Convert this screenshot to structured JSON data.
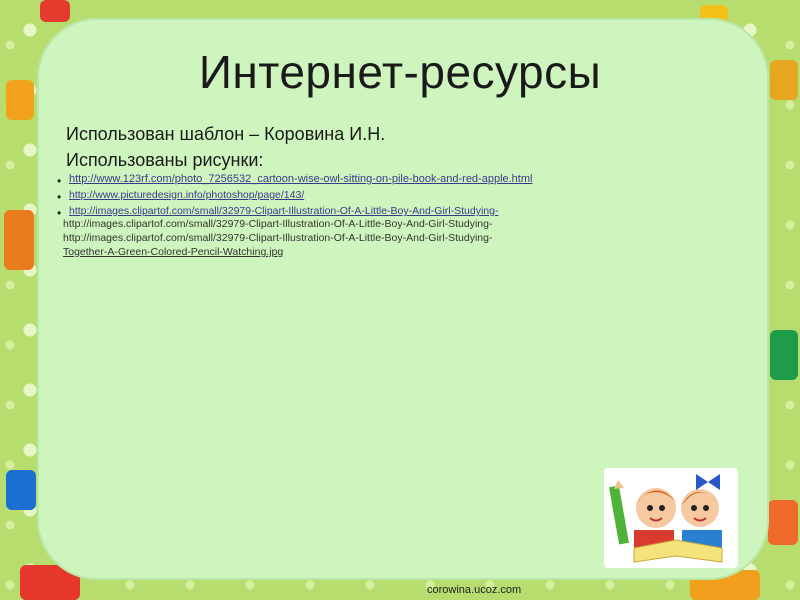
{
  "slide": {
    "title": "Интернет-ресурсы",
    "line1": "Использован шаблон – Коровина И.Н.",
    "line2": "Использованы рисунки:",
    "links": [
      "http://www.123rf.com/photo_7256532_cartoon-wise-owl-sitting-on-pile-book-and-red-apple.html",
      "http://www.picturedesign.info/photoshop/page/143/",
      "http://images.clipartof.com/small/32979-Clipart-Illustration-Of-A-Little-Boy-And-Girl-Studying-"
    ],
    "extra_lines": [
      "http://images.clipartof.com/small/32979-Clipart-Illustration-Of-A-Little-Boy-And-Girl-Studying-",
      "http://images.clipartof.com/small/32979-Clipart-Illustration-Of-A-Little-Boy-And-Girl-Studying-",
      "Together-A-Green-Colored-Pencil-Watching.jpg"
    ],
    "footer": "corowina.ucoz.com"
  },
  "colors": {
    "frame_bg": "#b7dd6e",
    "slide_bg": "#cff5bf",
    "link": "#3a3a8a"
  }
}
